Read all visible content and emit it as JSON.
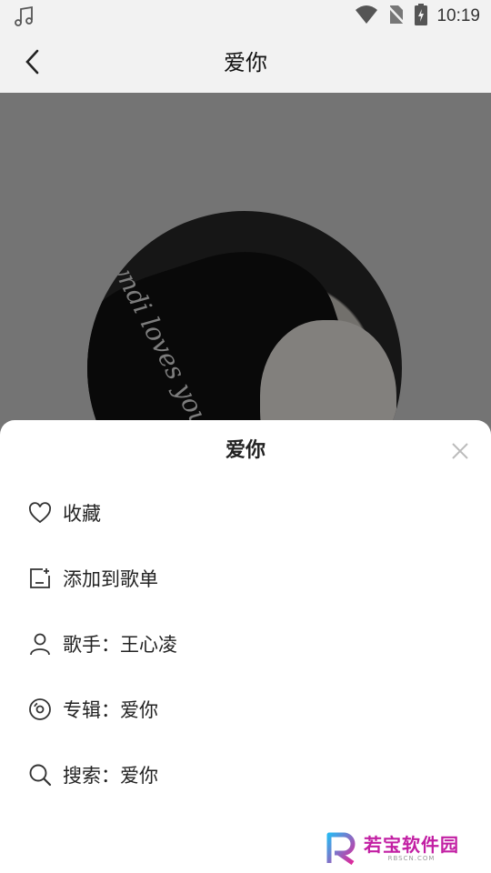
{
  "status_bar": {
    "time": "10:19",
    "icons": [
      "music-note-icon",
      "wifi-icon",
      "no-sim-icon",
      "battery-charging-icon"
    ]
  },
  "header": {
    "back_icon": "chevron-left-icon",
    "title": "爱你"
  },
  "album": {
    "cover_text": "Cyndi loves you"
  },
  "sheet": {
    "title": "爱你",
    "close_icon": "close-icon",
    "items": [
      {
        "icon": "heart-icon",
        "label": "收藏"
      },
      {
        "icon": "add-to-playlist-icon",
        "label": "添加到歌单"
      },
      {
        "icon": "person-icon",
        "label": "歌手：王心凌"
      },
      {
        "icon": "disc-icon",
        "label": "专辑：爱你"
      },
      {
        "icon": "search-icon",
        "label": "搜索：爱你"
      }
    ]
  },
  "watermark": {
    "name": "若宝软件园",
    "url": "RBSCN.COM"
  },
  "colors": {
    "overlay": "#787878",
    "sheet_bg": "#ffffff",
    "watermark_accent": "#c21fa3"
  }
}
